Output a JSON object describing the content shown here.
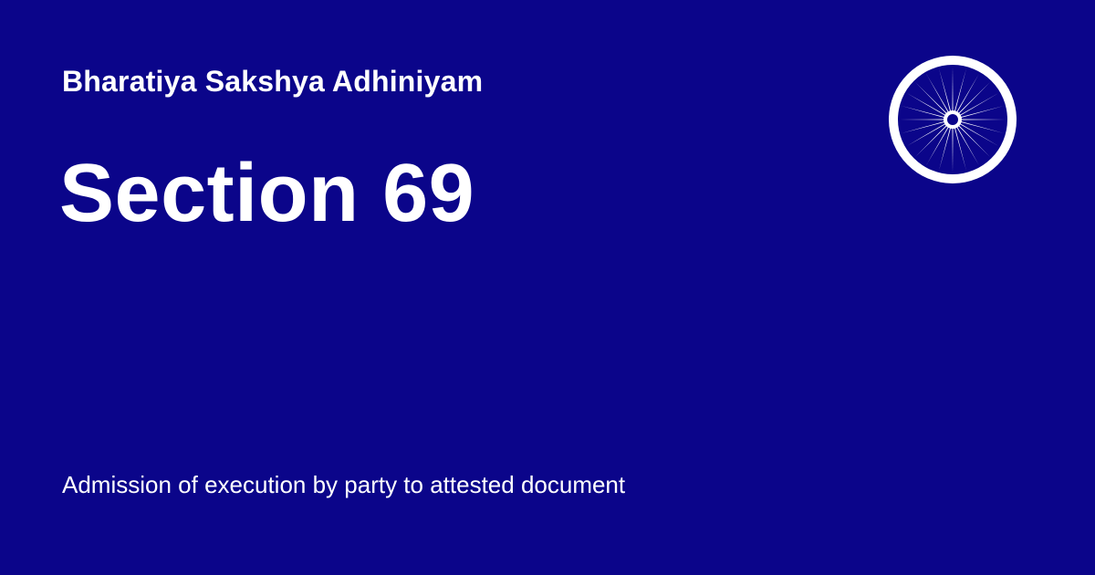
{
  "card": {
    "act_name": "Bharatiya Sakshya Adhiniyam",
    "section_title": "Section 69",
    "section_subtitle": "Admission of execution by party to attested document",
    "emblem_icon": "ashoka-chakra-icon"
  },
  "colors": {
    "background": "#0b058a",
    "text": "#ffffff",
    "emblem_fill": "#0b058a",
    "emblem_stroke": "#ffffff"
  }
}
